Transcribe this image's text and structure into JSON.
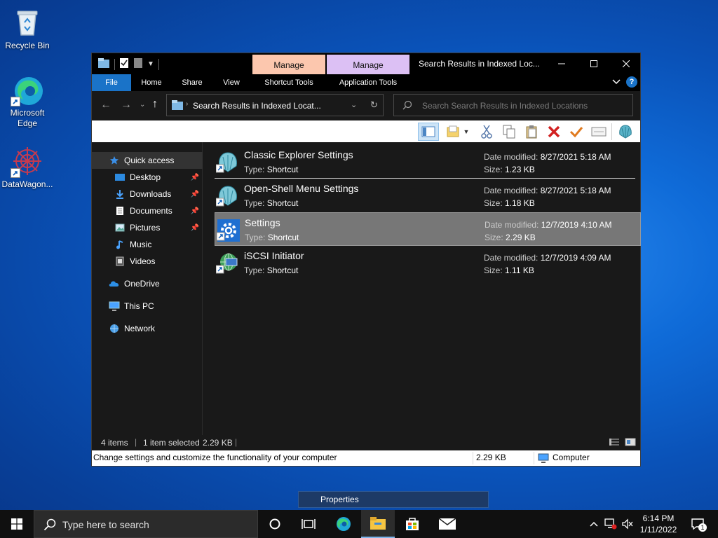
{
  "desktop": {
    "icons": [
      {
        "label": "Recycle Bin",
        "icon": "recycle-bin-icon"
      },
      {
        "label": "Microsoft Edge",
        "icon": "edge-icon"
      },
      {
        "label": "DataWagon...",
        "icon": "datawagon-icon"
      }
    ]
  },
  "window": {
    "title": "Search Results in Indexed Loc...",
    "context_tabs": [
      "Manage",
      "Manage"
    ],
    "ribbon_tabs": [
      "File",
      "Home",
      "Share",
      "View",
      "Shortcut Tools",
      "Application Tools"
    ],
    "help": "?",
    "address": "Search Results in Indexed Locat...",
    "search_placeholder": "Search Search Results in Indexed Locations"
  },
  "sidebar": {
    "items": [
      {
        "label": "Quick access",
        "icon": "star-icon",
        "pinned": false
      },
      {
        "label": "Desktop",
        "icon": "desktop-icon",
        "pinned": true
      },
      {
        "label": "Downloads",
        "icon": "downloads-icon",
        "pinned": true
      },
      {
        "label": "Documents",
        "icon": "documents-icon",
        "pinned": true
      },
      {
        "label": "Pictures",
        "icon": "pictures-icon",
        "pinned": true
      },
      {
        "label": "Music",
        "icon": "music-icon",
        "pinned": false
      },
      {
        "label": "Videos",
        "icon": "videos-icon",
        "pinned": false
      },
      {
        "label": "OneDrive",
        "icon": "onedrive-icon",
        "pinned": false
      },
      {
        "label": "This PC",
        "icon": "this-pc-icon",
        "pinned": false
      },
      {
        "label": "Network",
        "icon": "network-icon",
        "pinned": false
      }
    ]
  },
  "files": {
    "type_label": "Type:",
    "date_label": "Date modified:",
    "size_label": "Size:",
    "items": [
      {
        "name": "Classic Explorer Settings",
        "type": "Shortcut",
        "date": "8/27/2021 5:18 AM",
        "size": "1.23 KB",
        "selected": false
      },
      {
        "name": "Open-Shell Menu Settings",
        "type": "Shortcut",
        "date": "8/27/2021 5:18 AM",
        "size": "1.18 KB",
        "selected": false
      },
      {
        "name": "Settings",
        "type": "Shortcut",
        "date": "12/7/2019 4:10 AM",
        "size": "2.29 KB",
        "selected": true
      },
      {
        "name": "iSCSI Initiator",
        "type": "Shortcut",
        "date": "12/7/2019 4:09 AM",
        "size": "1.11 KB",
        "selected": false
      }
    ]
  },
  "status": {
    "count": "4 items",
    "selected": "1 item selected",
    "selected_size": "2.29 KB"
  },
  "details": {
    "description": "Change settings and customize the functionality of your computer",
    "size": "2.29 KB",
    "location": "Computer"
  },
  "tooltip": {
    "label": "Properties"
  },
  "taskbar": {
    "search_placeholder": "Type here to search",
    "time": "6:14 PM",
    "date": "1/11/2022",
    "notifications": "1"
  },
  "colors": {
    "accent": "#1a73c8",
    "manage_shortcut": "#fcc7ae",
    "manage_application": "#dcc0f4",
    "window_bg": "#191919"
  }
}
